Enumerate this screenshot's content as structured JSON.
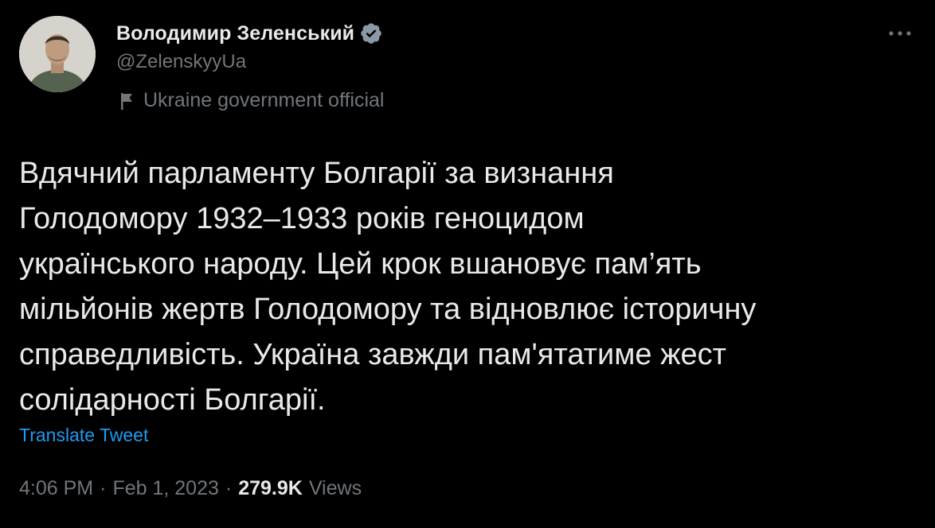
{
  "author": {
    "display_name": "Володимир Зеленський",
    "handle": "@ZelenskyyUa",
    "label": "Ukraine government official",
    "verified_color": "#8b98a5"
  },
  "tweet": {
    "lines": [
      "Вдячний парламенту Болгарії за визнання",
      "Голодомору 1932–1933 років геноцидом",
      "українського народу. Цей крок вшановує пам’ять",
      "мільйонів жертв Голодомору та відновлює історичну",
      "справедливість. Україна завжди пам'ятатиме жест",
      "солідарності Болгарії."
    ],
    "translate_label": "Translate Tweet"
  },
  "meta": {
    "time": "4:06 PM",
    "dot1": "·",
    "date": "Feb 1, 2023",
    "dot2": "·",
    "views_count": "279.9K",
    "views_label": "Views"
  },
  "icons": {
    "more": "more-icon",
    "verified": "verified-badge-icon",
    "flag": "flag-icon"
  },
  "colors": {
    "background": "#000000",
    "text": "#e7e9ea",
    "secondary": "#71767b",
    "link": "#1d9bf0"
  }
}
